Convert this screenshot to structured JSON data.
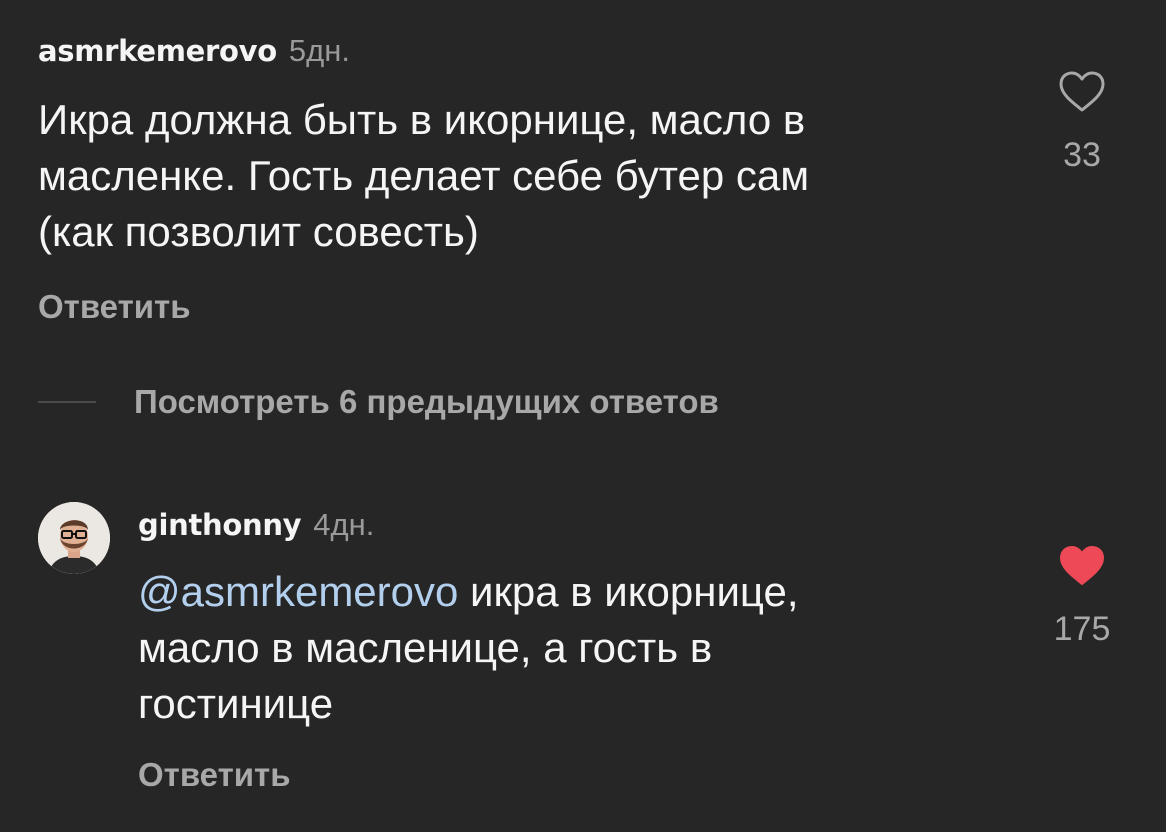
{
  "comments": [
    {
      "username": "asmrkemerovo",
      "time": "5дн.",
      "lines": [
        "Икра должна быть в икорнице, масло в",
        "масленке. Гость делает себе бутер сам",
        "(как позволит совесть)"
      ],
      "reply_label": "Ответить",
      "like_count": "33",
      "liked": false,
      "icon": "heart-outline-icon"
    },
    {
      "username": "ginthonny",
      "time": "4дн.",
      "mention": "@asmrkemerovo",
      "line1_rest": " икра в икорнице,",
      "line2": "масло в масленице, а гость в",
      "line3": "гостинице",
      "reply_label": "Ответить",
      "like_count": "175",
      "liked": true,
      "icon": "heart-filled-icon"
    }
  ],
  "view_replies_label": "Посмотреть 6 предыдущих ответов",
  "colors": {
    "background": "#262626",
    "text": "#f5f5f5",
    "muted": "#a8a8a8",
    "mention": "#b3cfee",
    "like_red": "#ed4956"
  }
}
